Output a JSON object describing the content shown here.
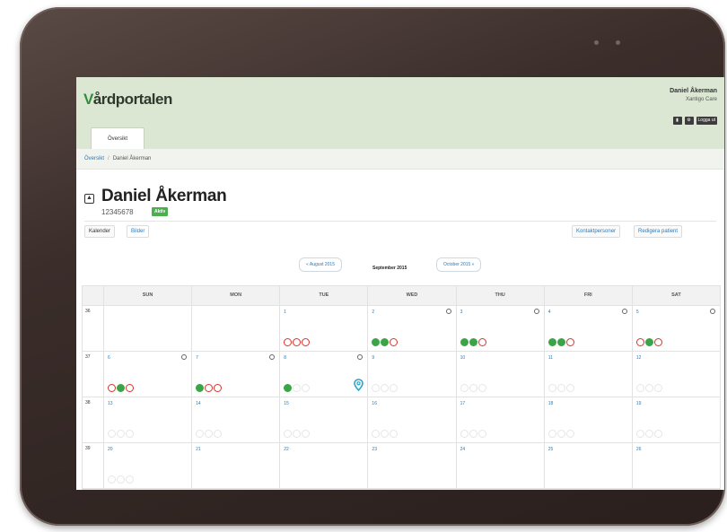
{
  "app": {
    "logo_first": "V",
    "logo_rest": "årdportalen",
    "user_name": "Daniel Åkerman",
    "user_company": "Xantigo Care",
    "header_buttons": [
      "",
      "",
      "Logga ut"
    ],
    "tab_label": "Översikt"
  },
  "breadcrumb": {
    "link": "Översikt",
    "sep": "/",
    "current": "Daniel Åkerman"
  },
  "patient": {
    "name": "Daniel Åkerman",
    "number": "12345678",
    "status": "Aktiv"
  },
  "subtabs": {
    "calendar": "Kalender",
    "files": "Bilder",
    "contacts": "Kontaktpersoner",
    "edit": "Redigera patient"
  },
  "month_nav": {
    "prev": "« August 2015",
    "current": "September 2015",
    "next": "October 2015 »"
  },
  "calendar": {
    "days": [
      "SUN",
      "MON",
      "TUE",
      "WED",
      "THU",
      "FRI",
      "SAT"
    ],
    "weeks": [
      {
        "week": "36",
        "cells": [
          {
            "date": "",
            "clock": false,
            "circles": []
          },
          {
            "date": "",
            "clock": false,
            "circles": []
          },
          {
            "date": "1",
            "clock": false,
            "circles": [
              "r",
              "r",
              "r"
            ]
          },
          {
            "date": "2",
            "clock": true,
            "circles": [
              "g",
              "g",
              "r"
            ]
          },
          {
            "date": "3",
            "clock": true,
            "circles": [
              "g",
              "g",
              "r"
            ]
          },
          {
            "date": "4",
            "clock": true,
            "circles": [
              "g",
              "g",
              "r"
            ]
          },
          {
            "date": "5",
            "clock": true,
            "circles": [
              "r",
              "g",
              "r"
            ]
          }
        ]
      },
      {
        "week": "37",
        "cells": [
          {
            "date": "6",
            "clock": true,
            "circles": [
              "r",
              "g",
              "r"
            ]
          },
          {
            "date": "7",
            "clock": true,
            "circles": [
              "g",
              "r",
              "r"
            ]
          },
          {
            "date": "8",
            "clock": true,
            "circles": [
              "g",
              "e",
              "e"
            ],
            "pin": true
          },
          {
            "date": "9",
            "clock": false,
            "circles": [
              "e",
              "e",
              "e"
            ]
          },
          {
            "date": "10",
            "clock": false,
            "circles": [
              "e",
              "e",
              "e"
            ]
          },
          {
            "date": "11",
            "clock": false,
            "circles": [
              "e",
              "e",
              "e"
            ]
          },
          {
            "date": "12",
            "clock": false,
            "circles": [
              "e",
              "e",
              "e"
            ]
          }
        ]
      },
      {
        "week": "38",
        "cells": [
          {
            "date": "13",
            "clock": false,
            "circles": [
              "e",
              "e",
              "e"
            ]
          },
          {
            "date": "14",
            "clock": false,
            "circles": [
              "e",
              "e",
              "e"
            ]
          },
          {
            "date": "15",
            "clock": false,
            "circles": [
              "e",
              "e",
              "e"
            ]
          },
          {
            "date": "16",
            "clock": false,
            "circles": [
              "e",
              "e",
              "e"
            ]
          },
          {
            "date": "17",
            "clock": false,
            "circles": [
              "e",
              "e",
              "e"
            ]
          },
          {
            "date": "18",
            "clock": false,
            "circles": [
              "e",
              "e",
              "e"
            ]
          },
          {
            "date": "19",
            "clock": false,
            "circles": [
              "e",
              "e",
              "e"
            ]
          }
        ]
      },
      {
        "week": "39",
        "cells": [
          {
            "date": "20",
            "clock": false,
            "circles": [
              "e",
              "e",
              "e"
            ]
          },
          {
            "date": "21",
            "clock": false,
            "circles": []
          },
          {
            "date": "22",
            "clock": false,
            "circles": []
          },
          {
            "date": "23",
            "clock": false,
            "circles": []
          },
          {
            "date": "24",
            "clock": false,
            "circles": []
          },
          {
            "date": "25",
            "clock": false,
            "circles": []
          },
          {
            "date": "26",
            "clock": false,
            "circles": []
          }
        ]
      }
    ]
  },
  "colors": {
    "header_bg": "#dbe7d2",
    "brand_green": "#2f8f3a",
    "done": "#3aa447",
    "missed": "#d9342b",
    "link": "#2f7ab3"
  }
}
